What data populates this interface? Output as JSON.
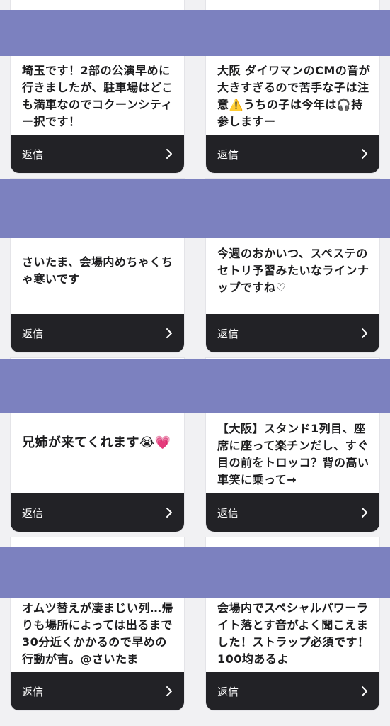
{
  "reply_label": "返信",
  "colors": {
    "band": "#7c81bf",
    "footer": "#222226",
    "card": "#ffffff",
    "page": "#f1f1f3"
  },
  "rows": [
    {
      "left": {
        "text": "埼玉です！2部の公演早めに行きましたが、駐車場はどこも満車なのでコクーンシティー択です！"
      },
      "right": {
        "text": "大阪 ダイワマンのCMの音が大きすぎるので苦手な子は注意⚠️うちの子は今年は🎧持参しますー"
      }
    },
    {
      "left": {
        "text": "さいたま、会場内めちゃくちゃ寒いです"
      },
      "right": {
        "text": "今週のおかいつ、スペステのセトリ予習みたいなラインナップですね♡"
      }
    },
    {
      "left": {
        "text": "兄姉が来てくれます😭💗"
      },
      "right": {
        "text": "【大阪】スタンド1列目、座席に座って楽チンだし、すぐ目の前をトロッコ？背の高い車笑に乗って→"
      }
    },
    {
      "left": {
        "text": "オムツ替えが凄まじい列…帰りも場所によっては出るまで30分近くかかるので早めの行動が吉。@さいたま"
      },
      "right": {
        "text": "会場内でスペシャルパワーライト落とす音がよく聞こえました！ストラップ必須です！100均あるよ"
      }
    }
  ]
}
